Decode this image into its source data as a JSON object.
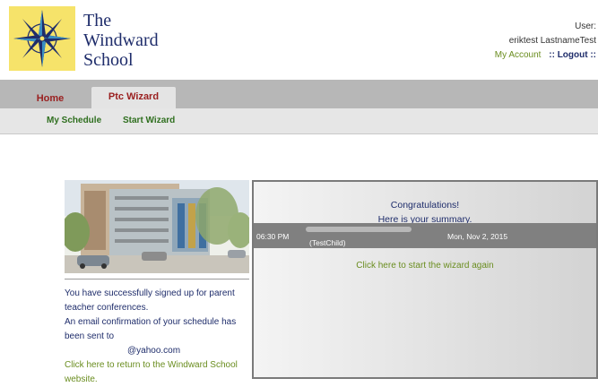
{
  "header": {
    "school_name_line1": "The",
    "school_name_line2": "Windward",
    "school_name_line3": "School",
    "user_label": "User:",
    "user_name": "eriktest LastnameTest",
    "my_account_label": "My Account",
    "logout_label": ":: Logout ::"
  },
  "tabs": [
    {
      "label": "Home"
    },
    {
      "label": "Ptc Wizard"
    }
  ],
  "subnav": [
    {
      "label": "My Schedule"
    },
    {
      "label": "Start Wizard"
    }
  ],
  "left_panel": {
    "message_lines": [
      "You have successfully signed up for parent",
      "teacher conferences.",
      "An email confirmation of your schedule has",
      "been sent to"
    ],
    "email": "@yahoo.com",
    "return_link_line1": "Click here to return to the Windward School",
    "return_link_line2": "website."
  },
  "summary": {
    "congrats_line1": "Congratulations!",
    "congrats_line2": "Here is your summary.",
    "time": "06:30 PM",
    "child": "(TestChild)",
    "date": "Mon, Nov 2, 2015",
    "restart_link": "Click here to start the wizard again"
  },
  "colors": {
    "navy": "#1f2d6b",
    "olive_green": "#6a8d1f",
    "tab_red": "#9a1f1f",
    "logo_yellow": "#f6e36a",
    "tabbar_gray": "#b7b7b7",
    "summary_row_gray": "#808080"
  },
  "icons": [
    "compass-rose-logo-icon",
    "building-illustration"
  ]
}
